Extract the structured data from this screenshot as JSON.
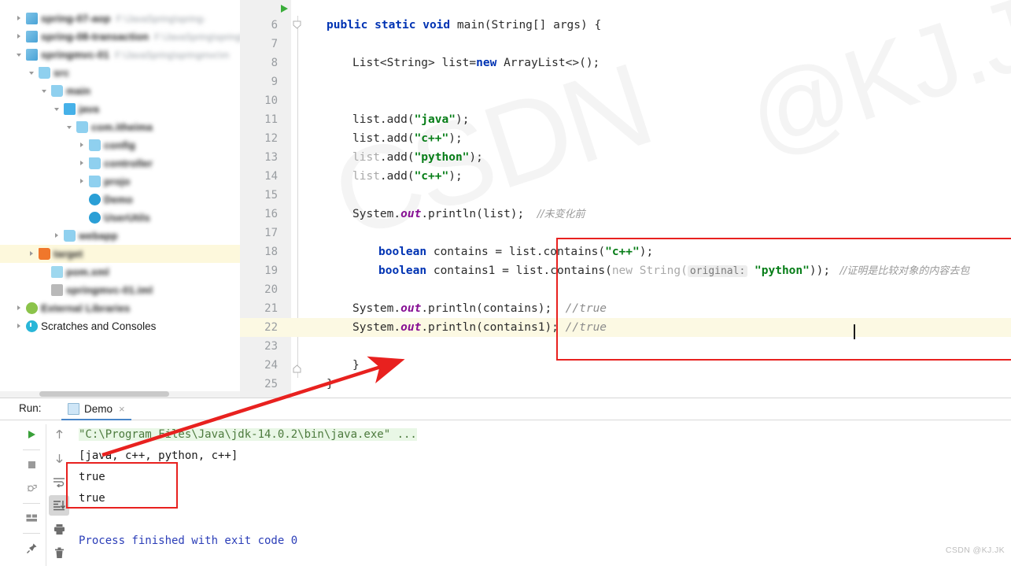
{
  "sidebar": {
    "tree": [
      {
        "label": "spring-07-aop",
        "path": "F:\\JavaSpring\\spring-",
        "icon": "module-icon",
        "arrow": "collapsed",
        "indent": 1,
        "blurred": true,
        "selected": false
      },
      {
        "label": "spring-08-transaction",
        "path": "F:\\JavaSpring\\spring\\",
        "icon": "module-icon",
        "arrow": "collapsed",
        "indent": 1,
        "blurred": true,
        "selected": false
      },
      {
        "label": "springmvc-01",
        "path": "F:\\JavaSpring\\springmvc\\m",
        "icon": "module-icon",
        "arrow": "expanded",
        "indent": 1,
        "blurred": true,
        "selected": false
      },
      {
        "label": "src",
        "path": "",
        "icon": "folder-icon",
        "arrow": "expanded",
        "indent": 2,
        "blurred": true,
        "selected": false
      },
      {
        "label": "main",
        "path": "",
        "icon": "folder-icon",
        "arrow": "expanded",
        "indent": 3,
        "blurred": true,
        "selected": false
      },
      {
        "label": "java",
        "path": "",
        "icon": "folder-java-icon",
        "arrow": "expanded",
        "indent": 4,
        "blurred": true,
        "selected": false
      },
      {
        "label": "com.itheima",
        "path": "",
        "icon": "folder-icon",
        "arrow": "expanded",
        "indent": 5,
        "blurred": true,
        "selected": false
      },
      {
        "label": "config",
        "path": "",
        "icon": "folder-icon",
        "arrow": "collapsed",
        "indent": 6,
        "blurred": true,
        "selected": false
      },
      {
        "label": "controller",
        "path": "",
        "icon": "folder-icon",
        "arrow": "collapsed",
        "indent": 6,
        "blurred": true,
        "selected": false
      },
      {
        "label": "projo",
        "path": "",
        "icon": "folder-icon",
        "arrow": "collapsed",
        "indent": 6,
        "blurred": true,
        "selected": false
      },
      {
        "label": "Demo",
        "path": "",
        "icon": "java-class-icon",
        "arrow": "none",
        "indent": 6,
        "blurred": true,
        "selected": false
      },
      {
        "label": "UserUtils",
        "path": "",
        "icon": "java-class-icon",
        "arrow": "none",
        "indent": 6,
        "blurred": true,
        "selected": false
      },
      {
        "label": "webapp",
        "path": "",
        "icon": "folder-icon",
        "arrow": "collapsed",
        "indent": 4,
        "blurred": true,
        "selected": false
      },
      {
        "label": "target",
        "path": "",
        "icon": "folder-orange-icon",
        "arrow": "collapsed",
        "indent": 2,
        "blurred": true,
        "selected": true
      },
      {
        "label": "pom.xml",
        "path": "",
        "icon": "xml-file-icon",
        "arrow": "none",
        "indent": 3,
        "blurred": true,
        "selected": false
      },
      {
        "label": "springmvc-01.iml",
        "path": "",
        "icon": "file-icon",
        "arrow": "none",
        "indent": 3,
        "blurred": true,
        "selected": false
      },
      {
        "label": "External Libraries",
        "path": "",
        "icon": "library-icon",
        "arrow": "collapsed",
        "indent": 1,
        "blurred": true,
        "selected": false
      },
      {
        "label": "Scratches and Consoles",
        "path": "",
        "icon": "scratches-icon",
        "arrow": "collapsed",
        "indent": 1,
        "blurred": false,
        "selected": false
      }
    ]
  },
  "editor": {
    "first_line": 6,
    "current_line": 22,
    "run_marker_line": 6,
    "lines": [
      {
        "num": 6,
        "segments": [
          {
            "t": "public ",
            "c": "kw"
          },
          {
            "t": "static ",
            "c": "kw"
          },
          {
            "t": "void ",
            "c": "kw"
          },
          {
            "t": "main(String[] args) {",
            "c": "plain"
          }
        ],
        "indent": 0
      },
      {
        "num": 7,
        "segments": [],
        "indent": 0
      },
      {
        "num": 8,
        "segments": [
          {
            "t": "List<String> list=",
            "c": "plain"
          },
          {
            "t": "new",
            "c": "kw"
          },
          {
            "t": " ArrayList<>();",
            "c": "plain"
          }
        ],
        "indent": 1
      },
      {
        "num": 9,
        "segments": [],
        "indent": 0
      },
      {
        "num": 10,
        "segments": [],
        "indent": 0
      },
      {
        "num": 11,
        "segments": [
          {
            "t": "list.add(",
            "c": "plain"
          },
          {
            "t": "\"java\"",
            "c": "str"
          },
          {
            "t": ");",
            "c": "plain"
          }
        ],
        "indent": 1
      },
      {
        "num": 12,
        "segments": [
          {
            "t": "list.add(",
            "c": "plain"
          },
          {
            "t": "\"c++\"",
            "c": "str"
          },
          {
            "t": ");",
            "c": "plain"
          }
        ],
        "indent": 1
      },
      {
        "num": 13,
        "segments": [
          {
            "t": "list",
            "c": "dim"
          },
          {
            "t": ".add(",
            "c": "plain"
          },
          {
            "t": "\"python\"",
            "c": "str"
          },
          {
            "t": ");",
            "c": "plain"
          }
        ],
        "indent": 1
      },
      {
        "num": 14,
        "segments": [
          {
            "t": "list",
            "c": "dim"
          },
          {
            "t": ".add(",
            "c": "plain"
          },
          {
            "t": "\"c++\"",
            "c": "str"
          },
          {
            "t": ");",
            "c": "plain"
          }
        ],
        "indent": 1
      },
      {
        "num": 15,
        "segments": [],
        "indent": 0
      },
      {
        "num": 16,
        "segments": [
          {
            "t": "System.",
            "c": "plain"
          },
          {
            "t": "out",
            "c": "field"
          },
          {
            "t": ".println(list);",
            "c": "plain"
          },
          {
            "t": "    //未变化前",
            "c": "cmt-cn"
          }
        ],
        "indent": 1
      },
      {
        "num": 17,
        "segments": [],
        "indent": 0
      },
      {
        "num": 18,
        "segments": [
          {
            "t": "boolean",
            "c": "kw"
          },
          {
            "t": " contains = list.contains(",
            "c": "plain"
          },
          {
            "t": "\"c++\"",
            "c": "str"
          },
          {
            "t": ");",
            "c": "plain"
          }
        ],
        "indent": 2
      },
      {
        "num": 19,
        "segments": [
          {
            "t": "boolean",
            "c": "kw"
          },
          {
            "t": " contains1 = list.contains(",
            "c": "plain"
          },
          {
            "t": "new String(",
            "c": "dim"
          },
          {
            "t": "original:",
            "c": "hint"
          },
          {
            "t": " ",
            "c": "plain"
          },
          {
            "t": "\"python\"",
            "c": "str"
          },
          {
            "t": "));",
            "c": "plain"
          },
          {
            "t": "   //证明是比较对象的内容去包",
            "c": "cmt-cn"
          }
        ],
        "indent": 2
      },
      {
        "num": 20,
        "segments": [],
        "indent": 0
      },
      {
        "num": 21,
        "segments": [
          {
            "t": "System.",
            "c": "plain"
          },
          {
            "t": "out",
            "c": "field"
          },
          {
            "t": ".println(contains);",
            "c": "plain"
          },
          {
            "t": "  //true",
            "c": "cmt"
          }
        ],
        "indent": 1
      },
      {
        "num": 22,
        "segments": [
          {
            "t": "System.",
            "c": "plain"
          },
          {
            "t": "out",
            "c": "field"
          },
          {
            "t": ".println(contains1);",
            "c": "plain"
          },
          {
            "t": " //true",
            "c": "cmt"
          }
        ],
        "indent": 1
      },
      {
        "num": 23,
        "segments": [],
        "indent": 0
      },
      {
        "num": 24,
        "segments": [
          {
            "t": "}",
            "c": "plain"
          }
        ],
        "indent": 1
      },
      {
        "num": 25,
        "segments": [
          {
            "t": "}",
            "c": "plain"
          }
        ],
        "indent": 0
      }
    ]
  },
  "run_panel": {
    "run_label": "Run:",
    "tab_name": "Demo",
    "tab_close": "×",
    "toolbar_left": [
      {
        "name": "rerun-button",
        "glyph": "play"
      },
      {
        "name": "stop-button",
        "glyph": "stop"
      },
      {
        "name": "rerun-failed-tests-button",
        "glyph": "bug"
      },
      {
        "name": "layout-button",
        "glyph": "layout"
      },
      {
        "name": "pin-tab-button",
        "glyph": "pin"
      }
    ],
    "toolbar_right": [
      {
        "name": "up-the-stack-trace-button",
        "glyph": "arrow-up"
      },
      {
        "name": "down-the-stack-trace-button",
        "glyph": "arrow-down"
      },
      {
        "name": "soft-wrap-button",
        "glyph": "soft-wrap"
      },
      {
        "name": "scroll-to-end-button",
        "glyph": "scroll-end",
        "active": true
      },
      {
        "name": "print-button",
        "glyph": "printer"
      },
      {
        "name": "clear-all-button",
        "glyph": "trash"
      }
    ],
    "console_lines": [
      {
        "text": "\"C:\\Program Files\\Java\\jdk-14.0.2\\bin\\java.exe\" ...",
        "style": "command"
      },
      {
        "text": "[java, c++, python, c++]",
        "style": "normal"
      },
      {
        "text": "true",
        "style": "normal"
      },
      {
        "text": "true",
        "style": "normal"
      },
      {
        "text": "",
        "style": "normal"
      },
      {
        "text": "Process finished with exit code 0",
        "style": "exit"
      }
    ]
  },
  "watermarks": {
    "big_left": "CSDN",
    "big_right": "@KJ.JK",
    "corner": "CSDN @KJ.JK"
  },
  "colors": {
    "annotation_red": "#e8211f",
    "keyword_blue": "#0033b3",
    "string_green": "#067d17",
    "field_purple": "#871094",
    "comment_gray": "#8c8c8c",
    "current_line_yellow": "#fcf9e3",
    "console_cmd_green_bg": "#e9f7e6"
  }
}
